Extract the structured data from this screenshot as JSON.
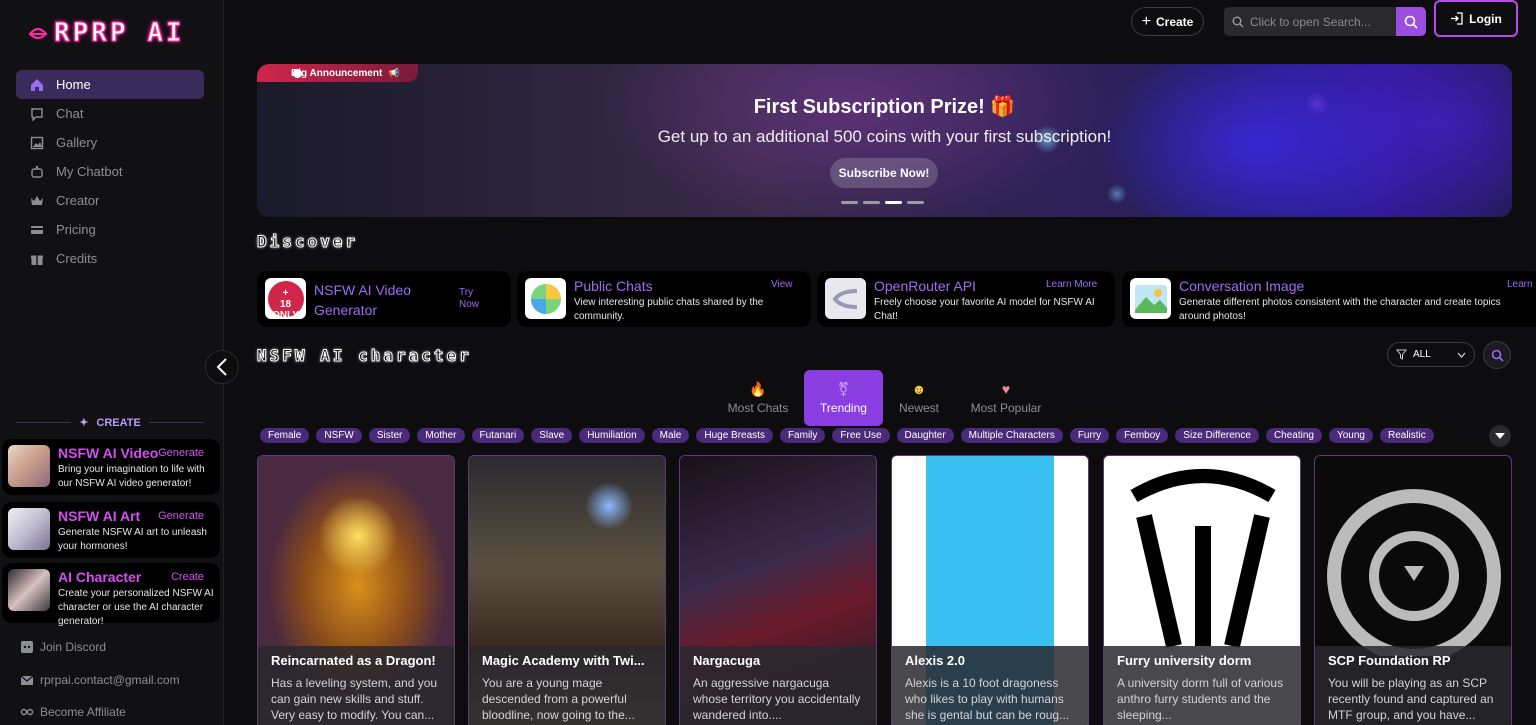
{
  "brand": {
    "name": "RPRP AI"
  },
  "sidebar": {
    "items": [
      {
        "label": "Home",
        "icon": "home-icon",
        "active": true
      },
      {
        "label": "Chat",
        "icon": "chat-icon"
      },
      {
        "label": "Gallery",
        "icon": "gallery-icon"
      },
      {
        "label": "My Chatbot",
        "icon": "bot-icon"
      },
      {
        "label": "Creator",
        "icon": "crown-icon"
      },
      {
        "label": "Pricing",
        "icon": "card-icon"
      },
      {
        "label": "Credits",
        "icon": "gift-icon"
      }
    ],
    "create_heading": "CREATE",
    "create_cards": [
      {
        "title": "NSFW AI Video",
        "action": "Generate",
        "desc": "Bring your imagination to life with our NSFW AI video generator!"
      },
      {
        "title": "NSFW AI Art",
        "action": "Generate",
        "desc": "Generate NSFW AI art to unleash your hormones!"
      },
      {
        "title": "AI Character",
        "action": "Create",
        "desc": "Create your personalized NSFW AI character or use the AI character generator!"
      }
    ],
    "footer": [
      {
        "label": "Join Discord",
        "icon": "discord-icon"
      },
      {
        "label": "rprpai.contact@gmail.com",
        "icon": "mail-icon"
      },
      {
        "label": "Become Affiliate",
        "icon": "affiliate-icon"
      }
    ]
  },
  "header": {
    "create_label": "Create",
    "search_placeholder": "Click to open Search...",
    "login_label": "Login"
  },
  "banner": {
    "tag": "Big Announcement",
    "title": "First Subscription Prize! 🎁",
    "subtitle": "Get up to an additional 500 coins with your first subscription!",
    "cta": "Subscribe Now!",
    "slides": 4,
    "active_slide": 3
  },
  "discover": {
    "title": "Discover",
    "cards": [
      {
        "title": "NSFW AI Video Generator",
        "action": "Try Now",
        "desc": ""
      },
      {
        "title": "Public Chats",
        "action": "View",
        "desc": "View interesting public chats shared by the community."
      },
      {
        "title": "OpenRouter API",
        "action": "Learn More",
        "desc": "Freely choose your favorite AI model for NSFW AI Chat!"
      },
      {
        "title": "Conversation Image",
        "action": "Learn More",
        "desc": "Generate different photos consistent with the character and create topics around photos!"
      }
    ]
  },
  "characters_section": {
    "title": "NSFW AI character",
    "filter_value": "ALL",
    "tabs": [
      {
        "label": "Most Chats",
        "emoji": "🔥"
      },
      {
        "label": "Trending",
        "emoji": "⚧",
        "active": true
      },
      {
        "label": "Newest",
        "emoji": "☻"
      },
      {
        "label": "Most Popular",
        "emoji": "♥"
      }
    ],
    "tags": [
      "Female",
      "NSFW",
      "Sister",
      "Mother",
      "Futanari",
      "Slave",
      "Humiliation",
      "Male",
      "Huge Breasts",
      "Family",
      "Free Use",
      "Daughter",
      "Multiple Characters",
      "Furry",
      "Femboy",
      "Size Difference",
      "Cheating",
      "Young",
      "Realistic"
    ],
    "cards": [
      {
        "name": "Reincarnated as a Dragon!",
        "desc": "Has a leveling system, and you can gain new skills and stuff. Very easy to modify. You can..."
      },
      {
        "name": "Magic Academy with Twi...",
        "desc": "You are a young mage descended from a powerful bloodline, now going to the..."
      },
      {
        "name": "Nargacuga",
        "desc": "An aggressive nargacuga whose territory you accidentally wandered into...."
      },
      {
        "name": "Alexis 2.0",
        "desc": "Alexis is a 10 foot dragoness who likes to play with humans she is gental but can be roug..."
      },
      {
        "name": "Furry university dorm",
        "desc": "A university dorm full of various anthro furry students and the sleeping..."
      },
      {
        "name": "SCP Foundation RP",
        "desc": "You will be playing as an SCP recently found and captured an MTF group, and you have..."
      }
    ]
  },
  "colors": {
    "accent": "#9b4de0",
    "pink": "#ff2aa0",
    "tag_bg": "#4a2a7a"
  }
}
